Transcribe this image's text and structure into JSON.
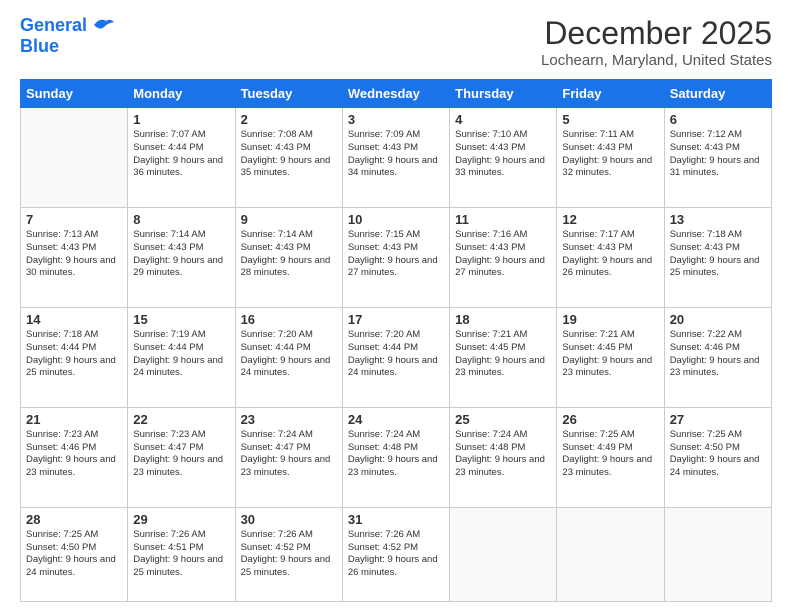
{
  "logo": {
    "line1": "General",
    "line2": "Blue"
  },
  "title": "December 2025",
  "subtitle": "Lochearn, Maryland, United States",
  "days_header": [
    "Sunday",
    "Monday",
    "Tuesday",
    "Wednesday",
    "Thursday",
    "Friday",
    "Saturday"
  ],
  "weeks": [
    [
      {
        "day": "",
        "sunrise": "",
        "sunset": "",
        "daylight": ""
      },
      {
        "day": "1",
        "sunrise": "Sunrise: 7:07 AM",
        "sunset": "Sunset: 4:44 PM",
        "daylight": "Daylight: 9 hours and 36 minutes."
      },
      {
        "day": "2",
        "sunrise": "Sunrise: 7:08 AM",
        "sunset": "Sunset: 4:43 PM",
        "daylight": "Daylight: 9 hours and 35 minutes."
      },
      {
        "day": "3",
        "sunrise": "Sunrise: 7:09 AM",
        "sunset": "Sunset: 4:43 PM",
        "daylight": "Daylight: 9 hours and 34 minutes."
      },
      {
        "day": "4",
        "sunrise": "Sunrise: 7:10 AM",
        "sunset": "Sunset: 4:43 PM",
        "daylight": "Daylight: 9 hours and 33 minutes."
      },
      {
        "day": "5",
        "sunrise": "Sunrise: 7:11 AM",
        "sunset": "Sunset: 4:43 PM",
        "daylight": "Daylight: 9 hours and 32 minutes."
      },
      {
        "day": "6",
        "sunrise": "Sunrise: 7:12 AM",
        "sunset": "Sunset: 4:43 PM",
        "daylight": "Daylight: 9 hours and 31 minutes."
      }
    ],
    [
      {
        "day": "7",
        "sunrise": "Sunrise: 7:13 AM",
        "sunset": "Sunset: 4:43 PM",
        "daylight": "Daylight: 9 hours and 30 minutes."
      },
      {
        "day": "8",
        "sunrise": "Sunrise: 7:14 AM",
        "sunset": "Sunset: 4:43 PM",
        "daylight": "Daylight: 9 hours and 29 minutes."
      },
      {
        "day": "9",
        "sunrise": "Sunrise: 7:14 AM",
        "sunset": "Sunset: 4:43 PM",
        "daylight": "Daylight: 9 hours and 28 minutes."
      },
      {
        "day": "10",
        "sunrise": "Sunrise: 7:15 AM",
        "sunset": "Sunset: 4:43 PM",
        "daylight": "Daylight: 9 hours and 27 minutes."
      },
      {
        "day": "11",
        "sunrise": "Sunrise: 7:16 AM",
        "sunset": "Sunset: 4:43 PM",
        "daylight": "Daylight: 9 hours and 27 minutes."
      },
      {
        "day": "12",
        "sunrise": "Sunrise: 7:17 AM",
        "sunset": "Sunset: 4:43 PM",
        "daylight": "Daylight: 9 hours and 26 minutes."
      },
      {
        "day": "13",
        "sunrise": "Sunrise: 7:18 AM",
        "sunset": "Sunset: 4:43 PM",
        "daylight": "Daylight: 9 hours and 25 minutes."
      }
    ],
    [
      {
        "day": "14",
        "sunrise": "Sunrise: 7:18 AM",
        "sunset": "Sunset: 4:44 PM",
        "daylight": "Daylight: 9 hours and 25 minutes."
      },
      {
        "day": "15",
        "sunrise": "Sunrise: 7:19 AM",
        "sunset": "Sunset: 4:44 PM",
        "daylight": "Daylight: 9 hours and 24 minutes."
      },
      {
        "day": "16",
        "sunrise": "Sunrise: 7:20 AM",
        "sunset": "Sunset: 4:44 PM",
        "daylight": "Daylight: 9 hours and 24 minutes."
      },
      {
        "day": "17",
        "sunrise": "Sunrise: 7:20 AM",
        "sunset": "Sunset: 4:44 PM",
        "daylight": "Daylight: 9 hours and 24 minutes."
      },
      {
        "day": "18",
        "sunrise": "Sunrise: 7:21 AM",
        "sunset": "Sunset: 4:45 PM",
        "daylight": "Daylight: 9 hours and 23 minutes."
      },
      {
        "day": "19",
        "sunrise": "Sunrise: 7:21 AM",
        "sunset": "Sunset: 4:45 PM",
        "daylight": "Daylight: 9 hours and 23 minutes."
      },
      {
        "day": "20",
        "sunrise": "Sunrise: 7:22 AM",
        "sunset": "Sunset: 4:46 PM",
        "daylight": "Daylight: 9 hours and 23 minutes."
      }
    ],
    [
      {
        "day": "21",
        "sunrise": "Sunrise: 7:23 AM",
        "sunset": "Sunset: 4:46 PM",
        "daylight": "Daylight: 9 hours and 23 minutes."
      },
      {
        "day": "22",
        "sunrise": "Sunrise: 7:23 AM",
        "sunset": "Sunset: 4:47 PM",
        "daylight": "Daylight: 9 hours and 23 minutes."
      },
      {
        "day": "23",
        "sunrise": "Sunrise: 7:24 AM",
        "sunset": "Sunset: 4:47 PM",
        "daylight": "Daylight: 9 hours and 23 minutes."
      },
      {
        "day": "24",
        "sunrise": "Sunrise: 7:24 AM",
        "sunset": "Sunset: 4:48 PM",
        "daylight": "Daylight: 9 hours and 23 minutes."
      },
      {
        "day": "25",
        "sunrise": "Sunrise: 7:24 AM",
        "sunset": "Sunset: 4:48 PM",
        "daylight": "Daylight: 9 hours and 23 minutes."
      },
      {
        "day": "26",
        "sunrise": "Sunrise: 7:25 AM",
        "sunset": "Sunset: 4:49 PM",
        "daylight": "Daylight: 9 hours and 23 minutes."
      },
      {
        "day": "27",
        "sunrise": "Sunrise: 7:25 AM",
        "sunset": "Sunset: 4:50 PM",
        "daylight": "Daylight: 9 hours and 24 minutes."
      }
    ],
    [
      {
        "day": "28",
        "sunrise": "Sunrise: 7:25 AM",
        "sunset": "Sunset: 4:50 PM",
        "daylight": "Daylight: 9 hours and 24 minutes."
      },
      {
        "day": "29",
        "sunrise": "Sunrise: 7:26 AM",
        "sunset": "Sunset: 4:51 PM",
        "daylight": "Daylight: 9 hours and 25 minutes."
      },
      {
        "day": "30",
        "sunrise": "Sunrise: 7:26 AM",
        "sunset": "Sunset: 4:52 PM",
        "daylight": "Daylight: 9 hours and 25 minutes."
      },
      {
        "day": "31",
        "sunrise": "Sunrise: 7:26 AM",
        "sunset": "Sunset: 4:52 PM",
        "daylight": "Daylight: 9 hours and 26 minutes."
      },
      {
        "day": "",
        "sunrise": "",
        "sunset": "",
        "daylight": ""
      },
      {
        "day": "",
        "sunrise": "",
        "sunset": "",
        "daylight": ""
      },
      {
        "day": "",
        "sunrise": "",
        "sunset": "",
        "daylight": ""
      }
    ]
  ]
}
